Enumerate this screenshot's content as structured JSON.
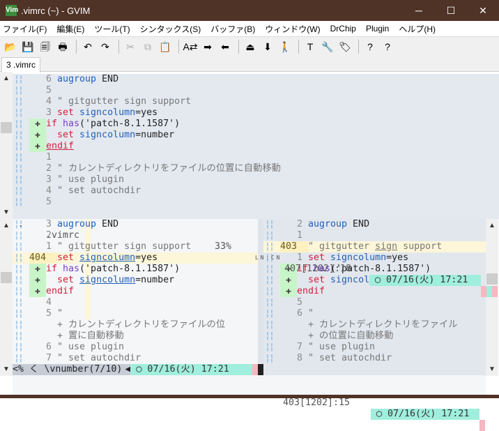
{
  "window": {
    "title": ".vimrc (~) - GVIM",
    "logo": "Vim",
    "minimize": "─",
    "maximize": "☐",
    "close": "✕"
  },
  "menu": [
    "ファイル(F)",
    "編集(E)",
    "ツール(T)",
    "シンタックス(S)",
    "バッファ(B)",
    "ウィンドウ(W)",
    "DrChip",
    "Plugin",
    "ヘルプ(H)"
  ],
  "toolbar": [
    {
      "name": "open-icon",
      "glyph": "📂"
    },
    {
      "name": "save-icon",
      "glyph": "💾"
    },
    {
      "name": "save-all-icon",
      "glyph": "🗐"
    },
    {
      "name": "print-icon",
      "glyph": "🖶"
    },
    {
      "sep": true
    },
    {
      "name": "undo-icon",
      "glyph": "↶"
    },
    {
      "name": "redo-icon",
      "glyph": "↷"
    },
    {
      "sep": true
    },
    {
      "name": "cut-icon",
      "glyph": "✂",
      "disabled": true
    },
    {
      "name": "copy-icon",
      "glyph": "⧉",
      "disabled": true
    },
    {
      "name": "paste-icon",
      "glyph": "📋"
    },
    {
      "sep": true
    },
    {
      "name": "replace-icon",
      "glyph": "A⇄"
    },
    {
      "name": "find-next-icon",
      "glyph": "➡"
    },
    {
      "name": "find-prev-icon",
      "glyph": "⬅"
    },
    {
      "sep": true
    },
    {
      "name": "load-session-icon",
      "glyph": "⏏"
    },
    {
      "name": "save-session-icon",
      "glyph": "⬇"
    },
    {
      "name": "run-script-icon",
      "glyph": "🚶"
    },
    {
      "sep": true
    },
    {
      "name": "make-icon",
      "glyph": "T"
    },
    {
      "name": "shell-icon",
      "glyph": "🔧"
    },
    {
      "name": "tags-icon",
      "glyph": "🏷"
    },
    {
      "sep": true
    },
    {
      "name": "help-icon",
      "glyph": "?"
    },
    {
      "name": "find-help-icon",
      "glyph": "?"
    }
  ],
  "tab": {
    "label": "3 .vimrc"
  },
  "panes": {
    "top": [
      {
        "n": "6",
        "s": [
          [
            "augroup",
            "k"
          ],
          [
            " END",
            "t"
          ]
        ]
      },
      {
        "n": "5",
        "s": []
      },
      {
        "n": "4",
        "s": [
          [
            "\" gitgutter sign support",
            "c"
          ]
        ]
      },
      {
        "n": "3",
        "s": [
          [
            "set",
            "r"
          ],
          [
            " signcolumn",
            "k"
          ],
          [
            "=yes",
            "t"
          ]
        ]
      },
      {
        "sign": "✚",
        "s": [
          [
            "if",
            "r"
          ],
          [
            " has",
            "p"
          ],
          [
            "('patch-8.1.1587')",
            "t"
          ]
        ]
      },
      {
        "sign": "✚",
        "s": [
          [
            "  set",
            "r"
          ],
          [
            " signcolumn",
            "k"
          ],
          [
            "=number",
            "t"
          ]
        ]
      },
      {
        "sign": "✚",
        "s": [
          [
            "endif",
            "r u"
          ]
        ]
      },
      {
        "n": "1",
        "s": []
      },
      {
        "n": "2",
        "s": [
          [
            "\" カレントディレクトリをファイルの位置に自動移動",
            "c"
          ]
        ]
      },
      {
        "n": "3",
        "s": [
          [
            "\" use plugin",
            "c"
          ]
        ]
      },
      {
        "n": "4",
        "s": [
          [
            "\" set autochdir",
            "c"
          ]
        ]
      },
      {
        "n": "5",
        "s": []
      }
    ],
    "left": [
      {
        "n": "3",
        "s": [
          [
            "augroup",
            "k"
          ],
          [
            " END",
            "t"
          ]
        ]
      },
      {
        "n": "2",
        "s": []
      },
      {
        "n": "1",
        "s": [
          [
            "\" gitgutter sign support",
            "c"
          ]
        ]
      },
      {
        "n": "404",
        "hl": true,
        "s": [
          [
            "set",
            "r"
          ],
          [
            " ",
            "t"
          ],
          [
            "signcolumn",
            "k u"
          ],
          [
            "=yes",
            "t"
          ]
        ]
      },
      {
        "sign": "✚",
        "s": [
          [
            "if",
            "r"
          ],
          [
            " has",
            "p"
          ],
          [
            "('patch-8.1.1587')",
            "t"
          ]
        ]
      },
      {
        "sign": "✚",
        "s": [
          [
            "  set",
            "r"
          ],
          [
            " ",
            "t"
          ],
          [
            "signcolumn",
            "k u"
          ],
          [
            "=number",
            "t"
          ]
        ]
      },
      {
        "sign": "✚",
        "s": [
          [
            "endif",
            "r"
          ]
        ]
      },
      {
        "n": "4",
        "s": []
      },
      {
        "n": "5",
        "s": [
          [
            "\"",
            "c"
          ]
        ]
      },
      {
        "n": "",
        "s": [
          [
            "+ カレントディレクトリをファイルの位",
            "c"
          ]
        ]
      },
      {
        "n": "",
        "s": [
          [
            "+ 置に自動移動",
            "c"
          ]
        ]
      },
      {
        "n": "6",
        "s": [
          [
            "\" use plugin",
            "c"
          ]
        ]
      },
      {
        "n": "7",
        "s": [
          [
            "\" set autochdir",
            "c"
          ]
        ]
      }
    ],
    "right": [
      {
        "n": "2",
        "s": [
          [
            "augroup",
            "k"
          ],
          [
            " END",
            "t"
          ]
        ]
      },
      {
        "n": "1",
        "s": []
      },
      {
        "n": "403",
        "hl": true,
        "s": [
          [
            "\" gitgutter ",
            "c"
          ],
          [
            "sign",
            "c u"
          ],
          [
            " support",
            "c"
          ]
        ]
      },
      {
        "n": "1",
        "s": [
          [
            "set",
            "r"
          ],
          [
            " signcolumn",
            "k"
          ],
          [
            "=yes",
            "t"
          ]
        ]
      },
      {
        "sign": "✚",
        "s": [
          [
            "if",
            "r"
          ],
          [
            " has",
            "p"
          ],
          [
            "('patch-8.1.1587')",
            "t"
          ]
        ]
      },
      {
        "sign": "✚",
        "s": [
          [
            "  set",
            "r"
          ],
          [
            " signcolumn",
            "k"
          ],
          [
            "=number",
            "t"
          ]
        ]
      },
      {
        "sign": "✚",
        "s": [
          [
            "endif",
            "r"
          ]
        ]
      },
      {
        "n": "5",
        "s": []
      },
      {
        "n": "6",
        "s": [
          [
            "\"",
            "c"
          ]
        ]
      },
      {
        "n": "",
        "s": [
          [
            "+ カレントディレクトリをファイル",
            "c"
          ]
        ]
      },
      {
        "n": "",
        "s": [
          [
            "+ の位置に自動移動",
            "c"
          ]
        ]
      },
      {
        "n": "7",
        "s": [
          [
            "\" use plugin",
            "c"
          ]
        ]
      },
      {
        "n": "8",
        "s": [
          [
            "\" set autochdir",
            "c"
          ]
        ]
      }
    ]
  },
  "status": {
    "top": {
      "mode": ".",
      "file": ".vimrc",
      "percent": "33%",
      "lnsym": "L N : C N",
      "pos": "407[1202]:18",
      "clock": "◯ 07/16(火) 17:21"
    },
    "left": {
      "percent": "<%",
      "func": "く \\vnumber(7/10)",
      "clock": "◯ 07/16(火) 17:21"
    },
    "right": {
      "sep": "<",
      "pos": "403[1202]:15",
      "clock": "◯ 07/16(火) 17:21"
    }
  }
}
